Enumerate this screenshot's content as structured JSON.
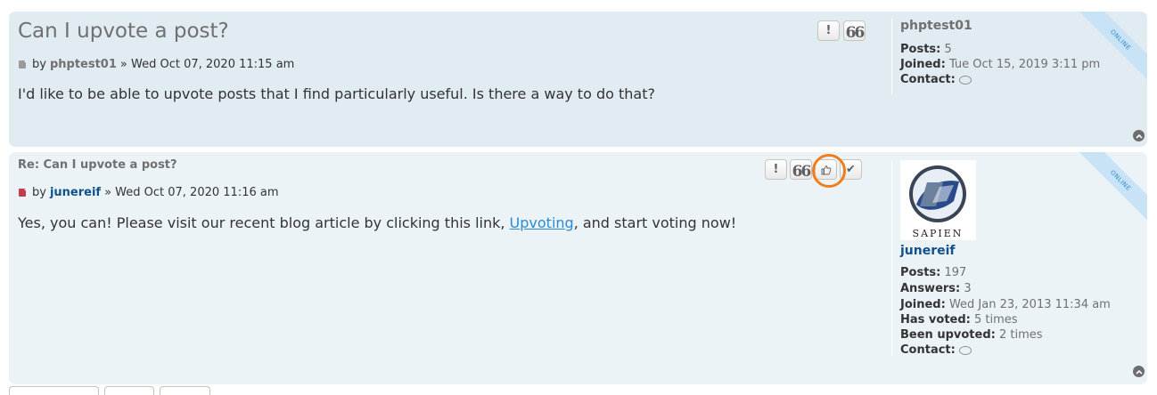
{
  "posts": [
    {
      "title": "Can I upvote a post?",
      "byline_prefix": "by",
      "author": "phptest01",
      "datetime": "» Wed Oct 07, 2020 11:15 am",
      "content": "I'd like to be able to upvote posts that I find particularly useful. Is there a way to do that?",
      "ribbon": "ONLINE",
      "buttons": {
        "report": "!",
        "quote": "66"
      },
      "profile": {
        "name": "phptest01",
        "posts_label": "Posts:",
        "posts_value": "5",
        "joined_label": "Joined:",
        "joined_value": "Tue Oct 15, 2019 3:11 pm",
        "contact_label": "Contact:"
      }
    },
    {
      "title": "Re: Can I upvote a post?",
      "byline_prefix": "by",
      "author": "junereif",
      "datetime": "» Wed Oct 07, 2020 11:16 am",
      "content_before": "Yes, you can! Please visit our recent blog article by clicking this link, ",
      "content_link": "Upvoting",
      "content_after": ", and start voting now!",
      "ribbon": "ONLINE",
      "buttons": {
        "report": "!",
        "quote": "66",
        "check": "✔"
      },
      "avatar_text": "SAPIEN",
      "profile": {
        "name": "junereif",
        "posts_label": "Posts:",
        "posts_value": "197",
        "answers_label": "Answers:",
        "answers_value": "3",
        "joined_label": "Joined:",
        "joined_value": "Wed Jan 23, 2013 11:34 am",
        "voted_label": "Has voted:",
        "voted_value": "5 times",
        "upvoted_label": "Been upvoted:",
        "upvoted_value": "2 times",
        "contact_label": "Contact:"
      }
    }
  ],
  "colors": {
    "post1_bg": "#e1ebf2",
    "post2_bg": "#ecf3f7",
    "highlight": "#f07d1c",
    "author_blue": "#105289",
    "link": "#2b8bd2"
  }
}
